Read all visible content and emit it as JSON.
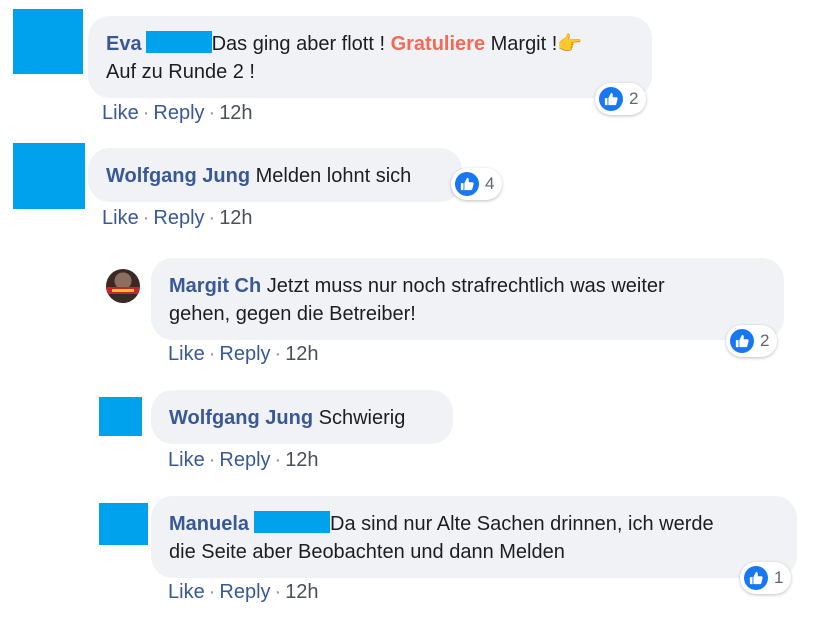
{
  "comments": [
    {
      "author": "Eva",
      "text_before": "Das ging aber flott ! ",
      "highlight": "Gratuliere",
      "text_after": " Margit !",
      "emoji": "👉",
      "line2": "Auf zu Runde 2 !",
      "reaction_count": "2",
      "actions": {
        "like": "Like",
        "reply": "Reply",
        "time": "12h"
      }
    },
    {
      "author": "Wolfgang Jung",
      "text": "Melden lohnt sich",
      "reaction_count": "4",
      "actions": {
        "like": "Like",
        "reply": "Reply",
        "time": "12h"
      }
    }
  ],
  "replies": [
    {
      "author": "Margit Ch",
      "line1": "Jetzt muss nur noch strafrechtlich was weiter",
      "line2": "gehen, gegen die Betreiber!",
      "reaction_count": "2",
      "actions": {
        "like": "Like",
        "reply": "Reply",
        "time": "12h"
      }
    },
    {
      "author": "Wolfgang Jung",
      "text": "Schwierig",
      "actions": {
        "like": "Like",
        "reply": "Reply",
        "time": "12h"
      }
    },
    {
      "author": "Manuela",
      "line1": "Da sind nur Alte Sachen drinnen, ich werde",
      "line2": "die Seite aber Beobachten und dann Melden",
      "reaction_count": "1",
      "actions": {
        "like": "Like",
        "reply": "Reply",
        "time": "12h"
      }
    }
  ],
  "separator": "·",
  "colors": {
    "name": "#385898",
    "highlight": "#f36b56",
    "redaction": "#00a2ed",
    "like": "#1877f2"
  }
}
